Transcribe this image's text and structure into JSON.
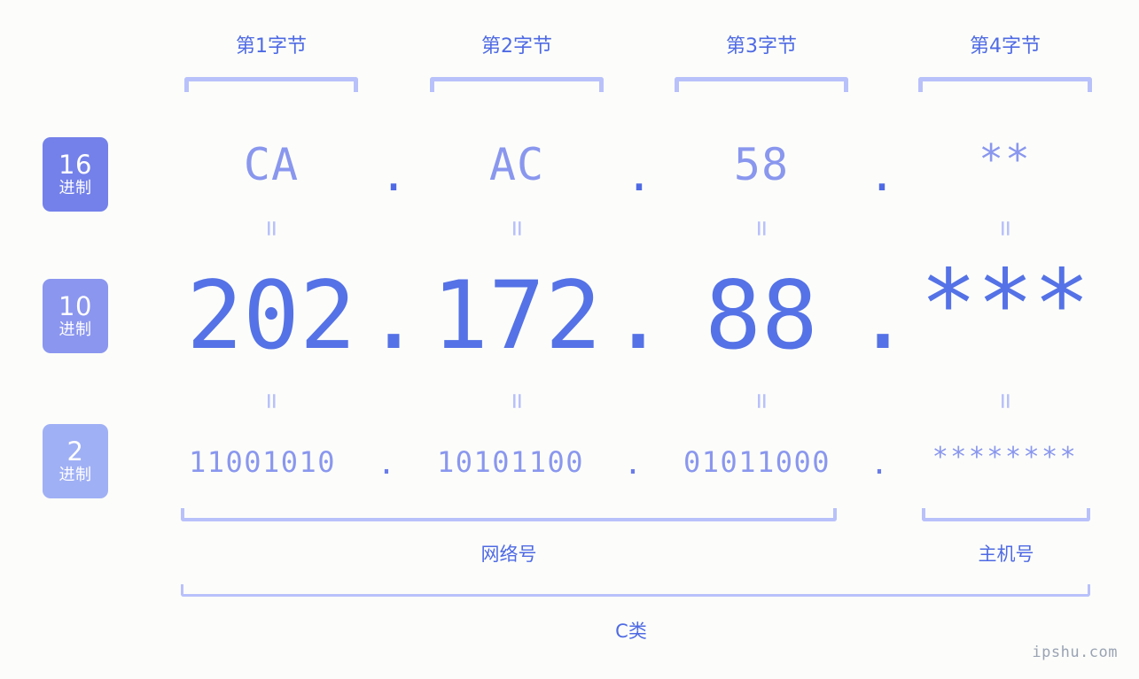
{
  "meta": {
    "watermark": "ipshu.com",
    "accent_strong": "#5572e6",
    "accent_mid": "#8a97ee",
    "accent_light": "#b9c1fb",
    "background": "#fcfdfa"
  },
  "byte_headers": [
    {
      "label": "第1字节"
    },
    {
      "label": "第2字节"
    },
    {
      "label": "第3字节"
    },
    {
      "label": "第4字节"
    }
  ],
  "bases": [
    {
      "num": "16",
      "sub": "进制",
      "color": "#7481ea"
    },
    {
      "num": "10",
      "sub": "进制",
      "color": "#8b96ef"
    },
    {
      "num": "2",
      "sub": "进制",
      "color": "#a0b0f5"
    }
  ],
  "rows": {
    "hex": {
      "name": "十六进制",
      "values": [
        "CA",
        "AC",
        "58",
        "**"
      ],
      "separator": "."
    },
    "decimal": {
      "name": "十进制",
      "values": [
        "202",
        "172",
        "88",
        "***"
      ],
      "separator": "."
    },
    "binary": {
      "name": "二进制",
      "values": [
        "11001010",
        "10101100",
        "01011000",
        "********"
      ],
      "separator": "."
    }
  },
  "equals_symbol": "=",
  "sections": {
    "network": "网络号",
    "host": "主机号",
    "class": "C类"
  },
  "ip": {
    "decimal_full": "202.172.88.***",
    "hex_full": "CA.AC.58.**",
    "binary_full": "11001010.10101100.01011000.********"
  }
}
